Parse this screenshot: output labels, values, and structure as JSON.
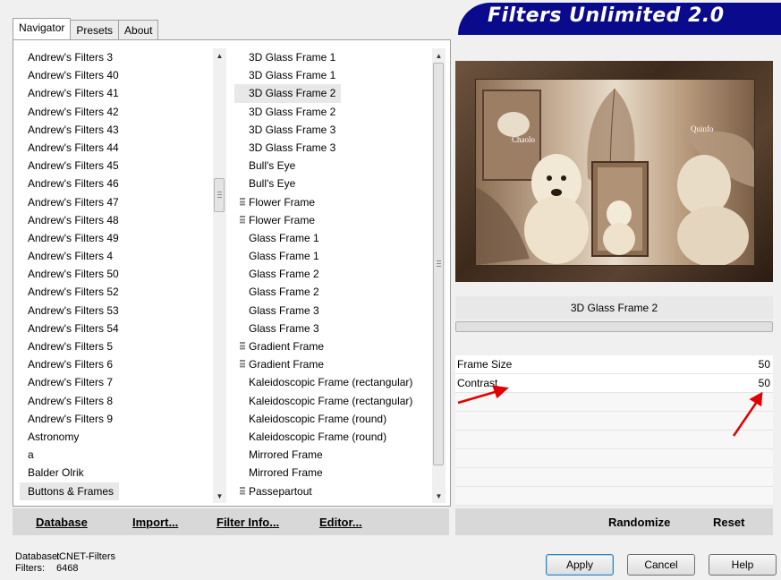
{
  "tabs": [
    "Navigator",
    "Presets",
    "About"
  ],
  "categories": [
    "Andrew's Filters 3",
    "Andrew's Filters 40",
    "Andrew's Filters 41",
    "Andrew's Filters 42",
    "Andrew's Filters 43",
    "Andrew's Filters 44",
    "Andrew's Filters 45",
    "Andrew's Filters 46",
    "Andrew's Filters 47",
    "Andrew's Filters 48",
    "Andrew's Filters 49",
    "Andrew's Filters 4",
    "Andrew's Filters 50",
    "Andrew's Filters 52",
    "Andrew's Filters 53",
    "Andrew's Filters 54",
    "Andrew's Filters 5",
    "Andrew's Filters 6",
    "Andrew's Filters 7",
    "Andrew's Filters 8",
    "Andrew's Filters 9",
    "Astronomy",
    "a",
    "Balder Olrik",
    "Buttons & Frames"
  ],
  "filters": [
    {
      "label": "3D Glass Frame 1",
      "grip": false
    },
    {
      "label": "3D Glass Frame 1",
      "grip": false
    },
    {
      "label": "3D Glass Frame 2",
      "grip": false
    },
    {
      "label": "3D Glass Frame 2",
      "grip": false
    },
    {
      "label": "3D Glass Frame 3",
      "grip": false
    },
    {
      "label": "3D Glass Frame 3",
      "grip": false
    },
    {
      "label": "Bull's Eye",
      "grip": false
    },
    {
      "label": "Bull's Eye",
      "grip": false
    },
    {
      "label": "Flower Frame",
      "grip": true
    },
    {
      "label": "Flower Frame",
      "grip": true
    },
    {
      "label": "Glass Frame 1",
      "grip": false
    },
    {
      "label": "Glass Frame 1",
      "grip": false
    },
    {
      "label": "Glass Frame 2",
      "grip": false
    },
    {
      "label": "Glass Frame 2",
      "grip": false
    },
    {
      "label": "Glass Frame 3",
      "grip": false
    },
    {
      "label": "Glass Frame 3",
      "grip": false
    },
    {
      "label": "Gradient Frame",
      "grip": true
    },
    {
      "label": "Gradient Frame",
      "grip": true
    },
    {
      "label": "Kaleidoscopic Frame (rectangular)",
      "grip": false
    },
    {
      "label": "Kaleidoscopic Frame (rectangular)",
      "grip": false
    },
    {
      "label": "Kaleidoscopic Frame (round)",
      "grip": false
    },
    {
      "label": "Kaleidoscopic Frame (round)",
      "grip": false
    },
    {
      "label": "Mirrored Frame",
      "grip": false
    },
    {
      "label": "Mirrored Frame",
      "grip": false
    },
    {
      "label": "Passepartout",
      "grip": true
    }
  ],
  "bottom_buttons": {
    "database": "Database",
    "import": "Import...",
    "filter_info": "Filter Info...",
    "editor": "Editor..."
  },
  "title": "Filters Unlimited 2.0",
  "preview": {
    "text_left": "Chaolo",
    "text_right": "Quinfo"
  },
  "current_filter": "3D Glass Frame 2",
  "params": [
    {
      "label": "Frame Size",
      "value": "50"
    },
    {
      "label": "Contrast",
      "value": "50"
    }
  ],
  "right_buttons": {
    "randomize": "Randomize",
    "reset": "Reset"
  },
  "status": {
    "database_label": "Database:",
    "database_value": "ICNET-Filters",
    "filters_label": "Filters:",
    "filters_value": "6468"
  },
  "dialog_buttons": {
    "apply": "Apply",
    "cancel": "Cancel",
    "help": "Help"
  },
  "colors": {
    "title_banner": "#0a0a8c",
    "arrow": "#e00000",
    "selected": "#e8e8e8"
  }
}
